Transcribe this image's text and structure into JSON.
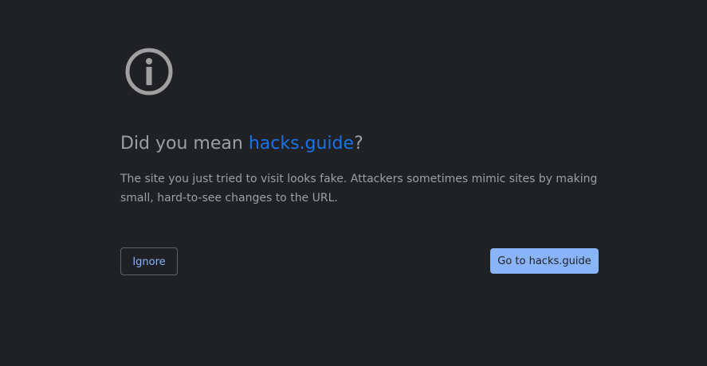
{
  "heading": {
    "prefix": "Did you mean ",
    "suggested_site": "hacks.guide",
    "suffix": "?"
  },
  "description": "The site you just tried to visit looks fake. Attackers sometimes mimic sites by making small, hard-to-see changes to the URL.",
  "buttons": {
    "ignore_label": "Ignore",
    "go_label": "Go to hacks.guide"
  },
  "icons": {
    "info": "info-icon"
  },
  "colors": {
    "background": "#202124",
    "text": "#9aa0a6",
    "link": "#1a73e8",
    "accent": "#8ab4f8",
    "icon": "#a0a0a0"
  }
}
